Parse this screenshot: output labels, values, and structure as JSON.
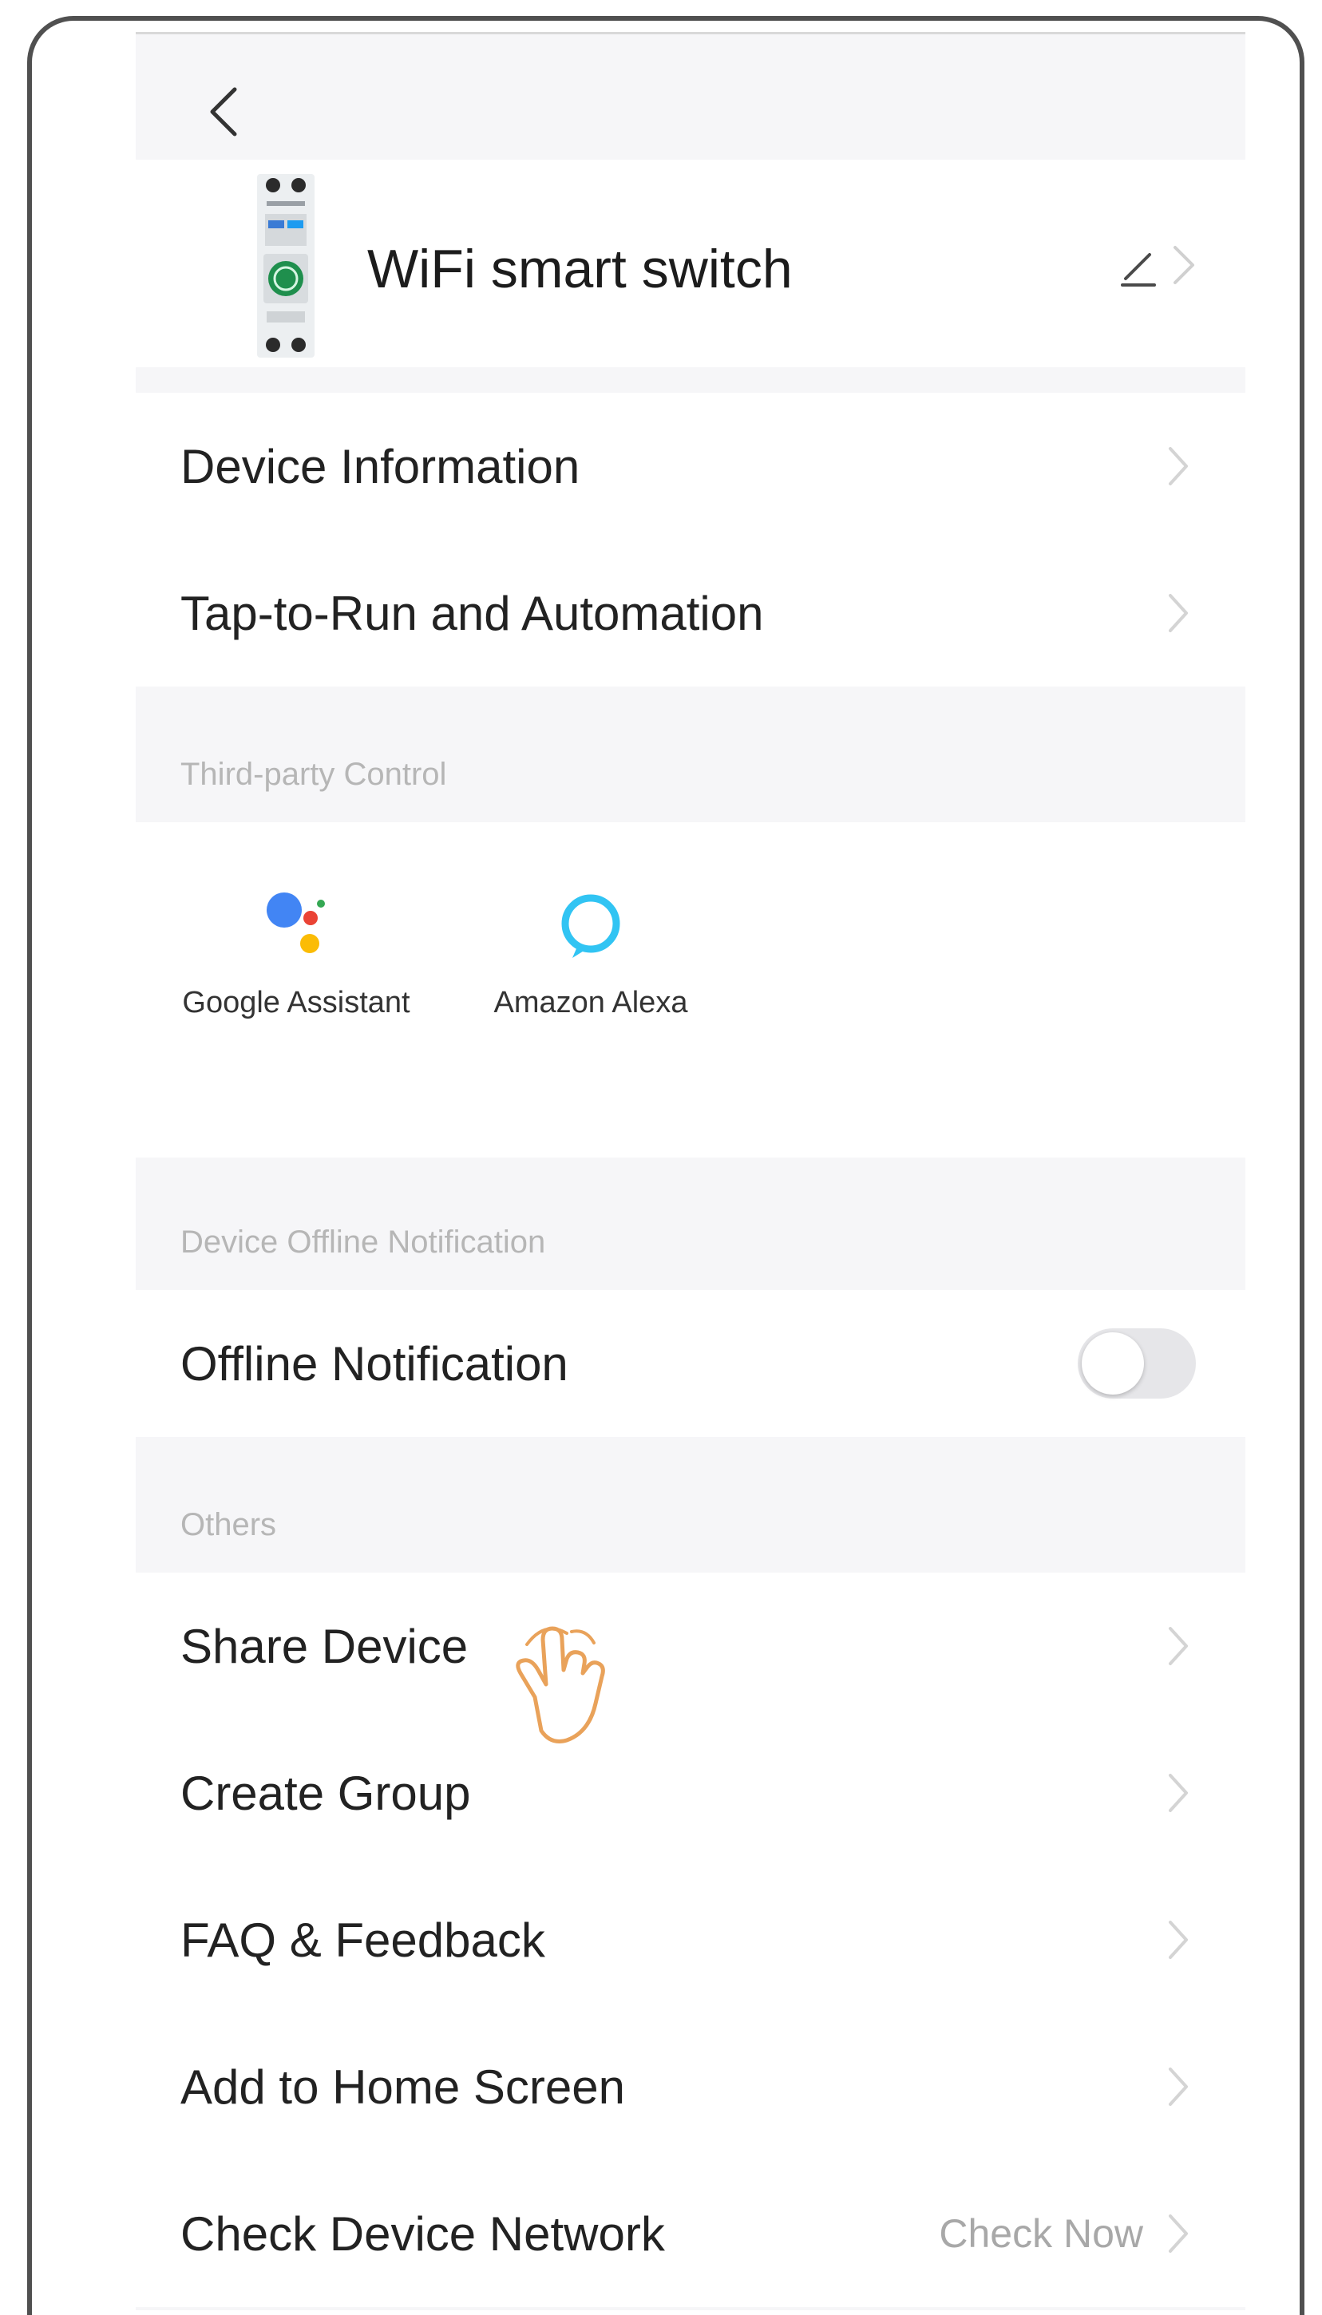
{
  "header": {
    "device_name": "WiFi smart switch"
  },
  "main_list": {
    "items": [
      {
        "label": "Device Information"
      },
      {
        "label": "Tap-to-Run and Automation"
      }
    ]
  },
  "third_party": {
    "title": "Third-party Control",
    "items": [
      {
        "label": "Google Assistant",
        "icon": "google-assistant-icon"
      },
      {
        "label": "Amazon Alexa",
        "icon": "amazon-alexa-icon"
      }
    ]
  },
  "offline": {
    "title": "Device Offline Notification",
    "label": "Offline Notification",
    "enabled": false
  },
  "others": {
    "title": "Others",
    "items": [
      {
        "label": "Share Device"
      },
      {
        "label": "Create Group"
      },
      {
        "label": "FAQ & Feedback"
      },
      {
        "label": "Add to Home Screen"
      },
      {
        "label": "Check Device Network",
        "value": "Check Now"
      }
    ]
  },
  "colors": {
    "background": "#f6f6f8",
    "card": "#ffffff",
    "section_title": "#b6b6b6",
    "hand_outline": "#e9a25a",
    "alexa_blue": "#31c4f3"
  }
}
